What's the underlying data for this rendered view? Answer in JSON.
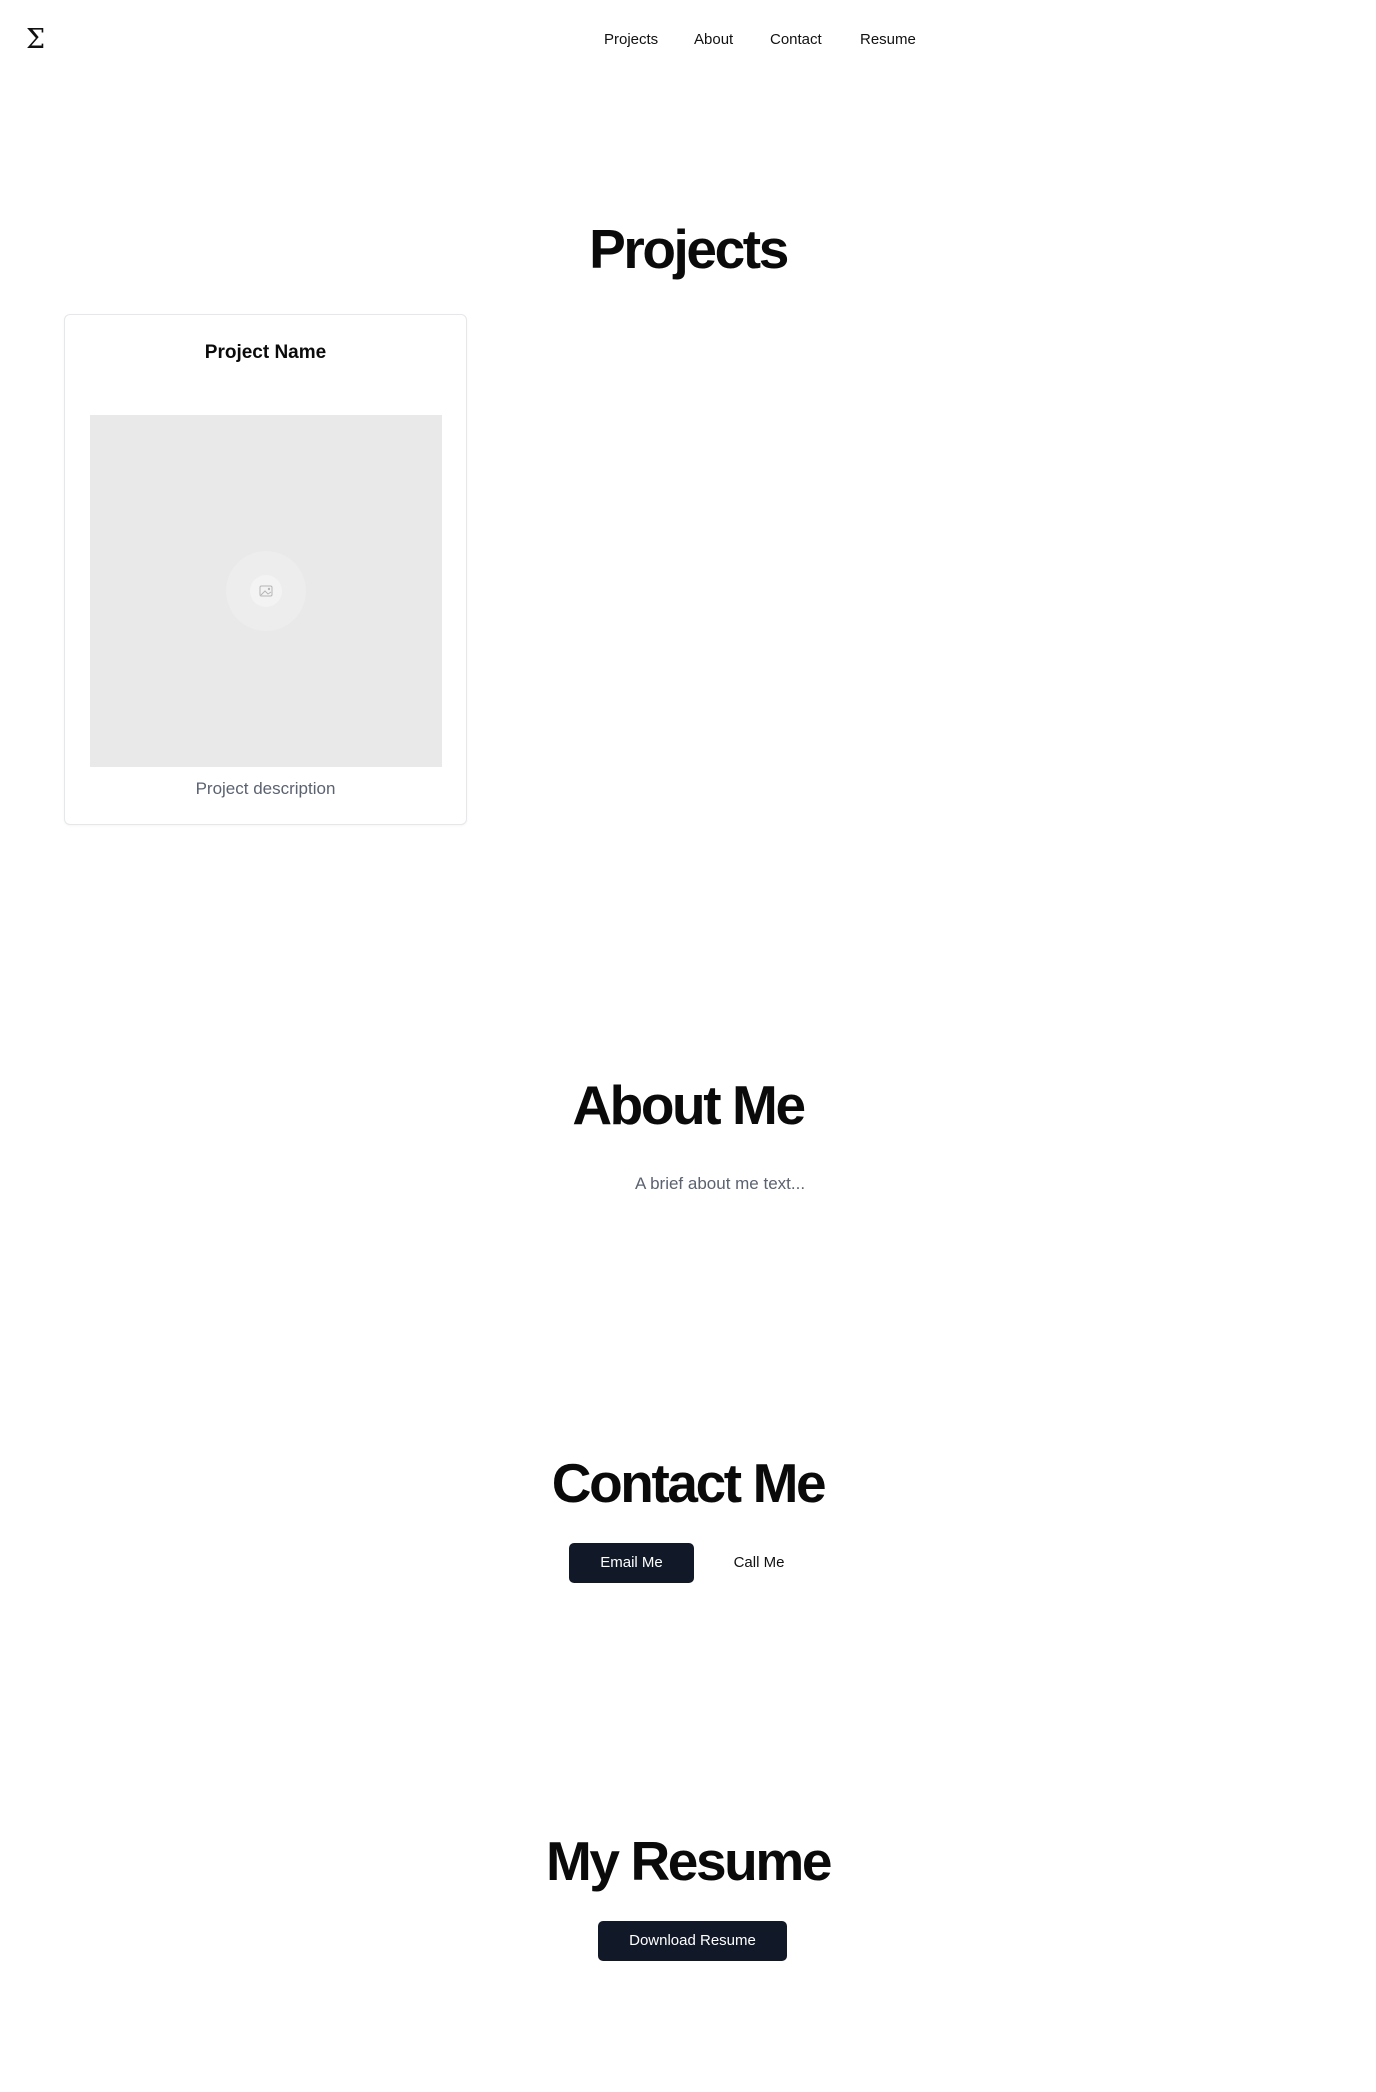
{
  "header": {
    "logo": "Σ",
    "nav": [
      "Projects",
      "About",
      "Contact",
      "Resume"
    ]
  },
  "projects": {
    "title": "Projects",
    "cards": [
      {
        "name": "Project Name",
        "description": "Project description",
        "image_icon": "image-placeholder-icon"
      }
    ]
  },
  "about": {
    "title": "About Me",
    "text": "A brief about me text..."
  },
  "contact": {
    "title": "Contact Me",
    "email_label": "Email Me",
    "call_label": "Call Me"
  },
  "resume": {
    "title": "My Resume",
    "download_label": "Download Resume"
  },
  "colors": {
    "primary_button": "#111827",
    "muted_text": "#5b6270",
    "placeholder_bg": "#e9e9e9",
    "card_border": "#e5e7eb"
  }
}
